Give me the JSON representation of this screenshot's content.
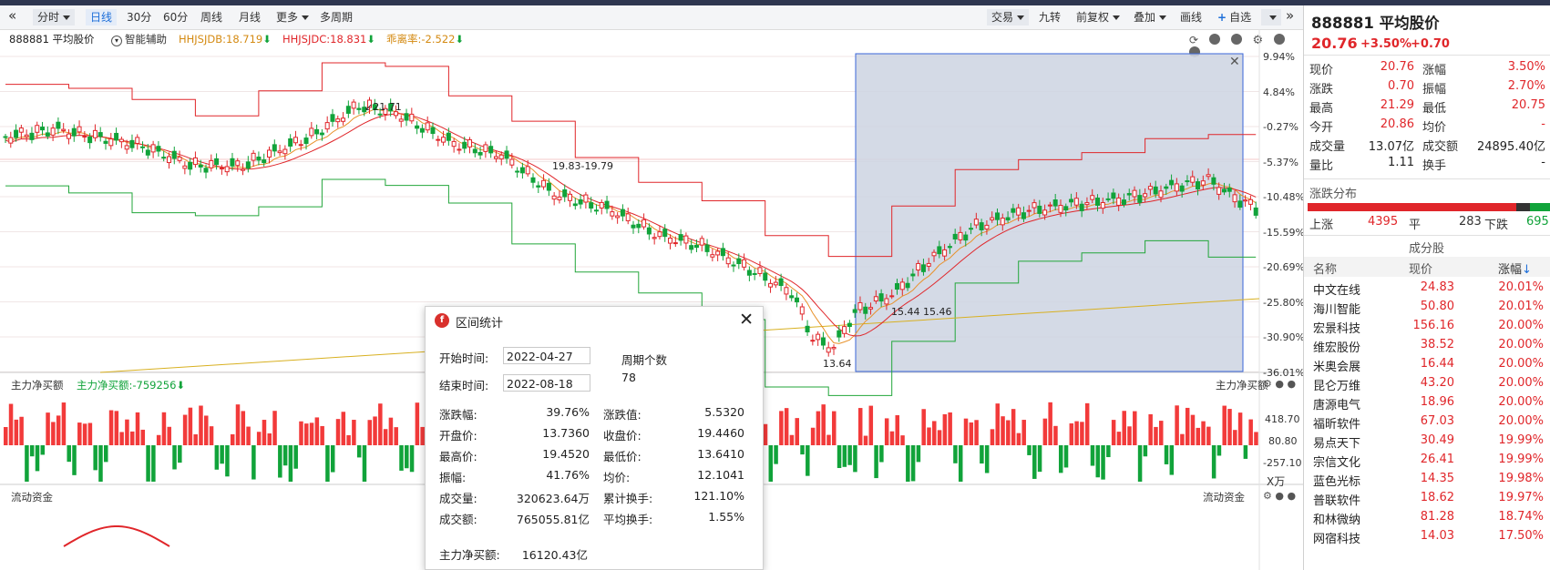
{
  "toolbar": {
    "collapse_icon": "double-chevron-left-icon",
    "items": [
      "分时",
      "日线",
      "30分",
      "60分",
      "周线",
      "月线",
      "更多",
      "多周期"
    ],
    "active": "日线",
    "right_items": [
      "交易",
      "九转",
      "前复权",
      "叠加",
      "画线",
      "自选"
    ],
    "expand_icon": "double-chevron-right-icon"
  },
  "indicators": {
    "stock": "888881 平均股价",
    "assist": "智能辅助",
    "hhjsjdb": "HHJSJDB:18.719",
    "hhjsjdc": "HHJSJDC:18.831",
    "deviation": "乖离率:-2.522"
  },
  "y_axis_labels": [
    "9.94%",
    "4.84%",
    "-0.27%",
    "-5.37%",
    "-10.48%",
    "-15.59%",
    "-20.69%",
    "-25.80%",
    "-30.90%",
    "-36.01%"
  ],
  "annotations": {
    "high": "21.71",
    "peak": "19.83-19.79",
    "low": "13.64",
    "mid": "15.44  15.46"
  },
  "flow_panel": {
    "title": "主力净买额",
    "value": "主力净买额:-759256",
    "title_right": "主力净买额",
    "axis": [
      "418.70",
      "80.80",
      "-257.10",
      "X万"
    ]
  },
  "fund_panel": {
    "title": "流动资金",
    "title_right": "流动资金"
  },
  "dialog": {
    "title": "区间统计",
    "start_label": "开始时间:",
    "start_value": "2022-04-27",
    "end_label": "结束时间:",
    "end_value": "2022-08-18",
    "period_label": "周期个数",
    "period_value": "78",
    "stats": [
      {
        "l1": "涨跌幅:",
        "v1": "39.76%",
        "l2": "涨跌值:",
        "v2": "5.5320"
      },
      {
        "l1": "开盘价:",
        "v1": "13.7360",
        "l2": "收盘价:",
        "v2": "19.4460"
      },
      {
        "l1": "最高价:",
        "v1": "19.4520",
        "l2": "最低价:",
        "v2": "13.6410"
      },
      {
        "l1": "振幅:",
        "v1": "41.76%",
        "l2": "均价:",
        "v2": "12.1041"
      },
      {
        "l1": "成交量:",
        "v1": "320623.64万",
        "l2": "累计换手:",
        "v2": "121.10%"
      },
      {
        "l1": "成交额:",
        "v1": "765055.81亿",
        "l2": "平均换手:",
        "v2": "1.55%"
      }
    ],
    "net_label": "主力净买额:",
    "net_value": "16120.43亿"
  },
  "quote": {
    "title": "888881 平均股价",
    "price": "20.76",
    "change_pct": "+3.50%",
    "change": "+0.70",
    "rows": [
      {
        "l1": "现价",
        "v1": "20.76",
        "l2": "涨幅",
        "v2": "3.50%",
        "c": "red"
      },
      {
        "l1": "涨跌",
        "v1": "0.70",
        "l2": "振幅",
        "v2": "2.70%",
        "c": "red"
      },
      {
        "l1": "最高",
        "v1": "21.29",
        "l2": "最低",
        "v2": "20.75",
        "c": "red"
      },
      {
        "l1": "今开",
        "v1": "20.86",
        "l2": "均价",
        "v2": "-",
        "c": "red"
      },
      {
        "l1": "成交量",
        "v1": "13.07亿",
        "l2": "成交额",
        "v2": "24895.40亿",
        "c": "black"
      },
      {
        "l1": "量比",
        "v1": "1.11",
        "l2": "换手",
        "v2": "-",
        "c": "black"
      }
    ],
    "dist_title": "涨跌分布",
    "up_label": "上涨",
    "up": "4395",
    "flat_label": "平",
    "flat": "283",
    "down_label": "下跌",
    "down": "695",
    "components_title": "成分股",
    "headers": [
      "名称",
      "现价",
      "涨幅"
    ],
    "stocks": [
      {
        "name": "中文在线",
        "price": "24.83",
        "pct": "20.01%"
      },
      {
        "name": "海川智能",
        "price": "50.80",
        "pct": "20.01%"
      },
      {
        "name": "宏景科技",
        "price": "156.16",
        "pct": "20.00%"
      },
      {
        "name": "维宏股份",
        "price": "38.52",
        "pct": "20.00%"
      },
      {
        "name": "米奥会展",
        "price": "16.44",
        "pct": "20.00%"
      },
      {
        "name": "昆仑万维",
        "price": "43.20",
        "pct": "20.00%"
      },
      {
        "name": "唐源电气",
        "price": "18.96",
        "pct": "20.00%"
      },
      {
        "name": "福昕软件",
        "price": "67.03",
        "pct": "20.00%"
      },
      {
        "name": "易点天下",
        "price": "30.49",
        "pct": "19.99%"
      },
      {
        "name": "宗信文化",
        "price": "26.41",
        "pct": "19.99%"
      },
      {
        "name": "蓝色光标",
        "price": "14.35",
        "pct": "19.98%"
      },
      {
        "name": "普联软件",
        "price": "18.62",
        "pct": "19.97%"
      },
      {
        "name": "和林微纳",
        "price": "81.28",
        "pct": "18.74%"
      },
      {
        "name": "网宿科技",
        "price": "14.03",
        "pct": "17.50%"
      }
    ]
  },
  "colors": {
    "up": "#e0262a",
    "down": "#11a33a",
    "selection": "#3a66d8"
  }
}
